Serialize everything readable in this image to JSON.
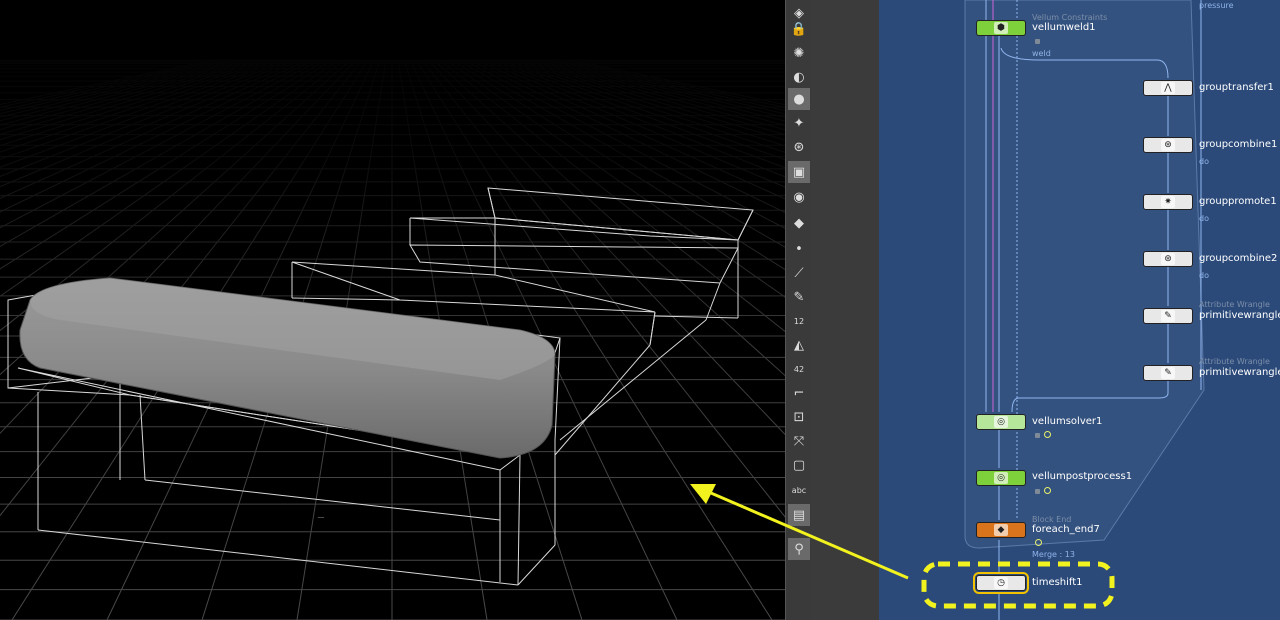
{
  "viewport": {
    "floor_marker": "_"
  },
  "toolbar": {
    "tools": [
      {
        "name": "handle-tool-icon",
        "glyph": "◈",
        "active": false
      },
      {
        "name": "lock-icon",
        "glyph": "🔒",
        "active": false
      },
      {
        "name": "lightbulb-off-icon",
        "glyph": "✺",
        "active": false
      },
      {
        "name": "sphere-icon",
        "glyph": "◐",
        "active": false
      },
      {
        "name": "light-icon",
        "glyph": "●",
        "active": true
      },
      {
        "name": "point-light-icon",
        "glyph": "✦",
        "active": false
      },
      {
        "name": "camera-light-icon",
        "glyph": "⊛",
        "active": false
      },
      {
        "name": "render-view-icon",
        "glyph": "▣",
        "active": true
      },
      {
        "name": "eye-select-icon",
        "glyph": "◉",
        "active": false
      },
      {
        "name": "transform-icon",
        "glyph": "◆",
        "active": false
      },
      {
        "name": "point-icon",
        "glyph": "•",
        "active": false
      },
      {
        "name": "brush-icon",
        "glyph": "⟋",
        "active": false
      },
      {
        "name": "pen-icon",
        "glyph": "✎",
        "active": false
      },
      {
        "name": "point-number-icon",
        "glyph": "12",
        "active": false
      },
      {
        "name": "primitive-icon",
        "glyph": "◭",
        "active": false
      },
      {
        "name": "vertex-number-icon",
        "glyph": "42",
        "active": false
      },
      {
        "name": "corner-icon",
        "glyph": "⌐",
        "active": false
      },
      {
        "name": "bounding-box-icon",
        "glyph": "⊡",
        "active": false
      },
      {
        "name": "normal-icon",
        "glyph": "⤧",
        "active": false
      },
      {
        "name": "square-icon",
        "glyph": "▢",
        "active": false
      },
      {
        "name": "text-icon",
        "glyph": "abc",
        "active": false
      },
      {
        "name": "image-icon",
        "glyph": "▤",
        "active": true
      },
      {
        "name": "pin-icon",
        "glyph": "⚲",
        "active": true
      }
    ]
  },
  "network": {
    "top_label": "pressure",
    "weld_label": "weld",
    "nodes": [
      {
        "id": "vellumweld1",
        "label": "vellumweld1",
        "type": "Vellum Constraints",
        "sub": "",
        "color": "green",
        "icon": "⬢"
      },
      {
        "id": "grouptransfer1",
        "label": "grouptransfer1",
        "type": "",
        "sub": "",
        "color": "white",
        "icon": "⋀"
      },
      {
        "id": "groupcombine1",
        "label": "groupcombine1",
        "type": "",
        "sub": "do",
        "color": "white",
        "icon": "⊛"
      },
      {
        "id": "grouppromote1",
        "label": "grouppromote1",
        "type": "",
        "sub": "do",
        "color": "white",
        "icon": "✷"
      },
      {
        "id": "groupcombine2",
        "label": "groupcombine2",
        "type": "",
        "sub": "do",
        "color": "white",
        "icon": "⊛"
      },
      {
        "id": "primitivewrangle1",
        "label": "primitivewrangle",
        "type": "Attribute Wrangle",
        "sub": "",
        "color": "white",
        "icon": "✎"
      },
      {
        "id": "primitivewrangle2",
        "label": "primitivewrangle",
        "type": "Attribute Wrangle",
        "sub": "",
        "color": "white",
        "icon": "✎"
      },
      {
        "id": "vellumsolver1",
        "label": "vellumsolver1",
        "type": "",
        "sub": "",
        "color": "lightgreen",
        "icon": "◎"
      },
      {
        "id": "vellumpostprocess1",
        "label": "vellumpostprocess1",
        "type": "",
        "sub": "",
        "color": "green",
        "icon": "◎"
      },
      {
        "id": "foreach_end7",
        "label": "foreach_end7",
        "type": "Block End",
        "sub": "Merge : 13",
        "color": "orange",
        "icon": "◆"
      },
      {
        "id": "timeshift1",
        "label": "timeshift1",
        "type": "",
        "sub": "",
        "color": "white",
        "icon": "◷"
      }
    ]
  },
  "colors": {
    "network_bg": "#2b4a7a",
    "highlight": "#f2f21e",
    "node_green": "#7fd13b",
    "node_orange": "#d9741c",
    "wire": "#8fb6f0"
  }
}
